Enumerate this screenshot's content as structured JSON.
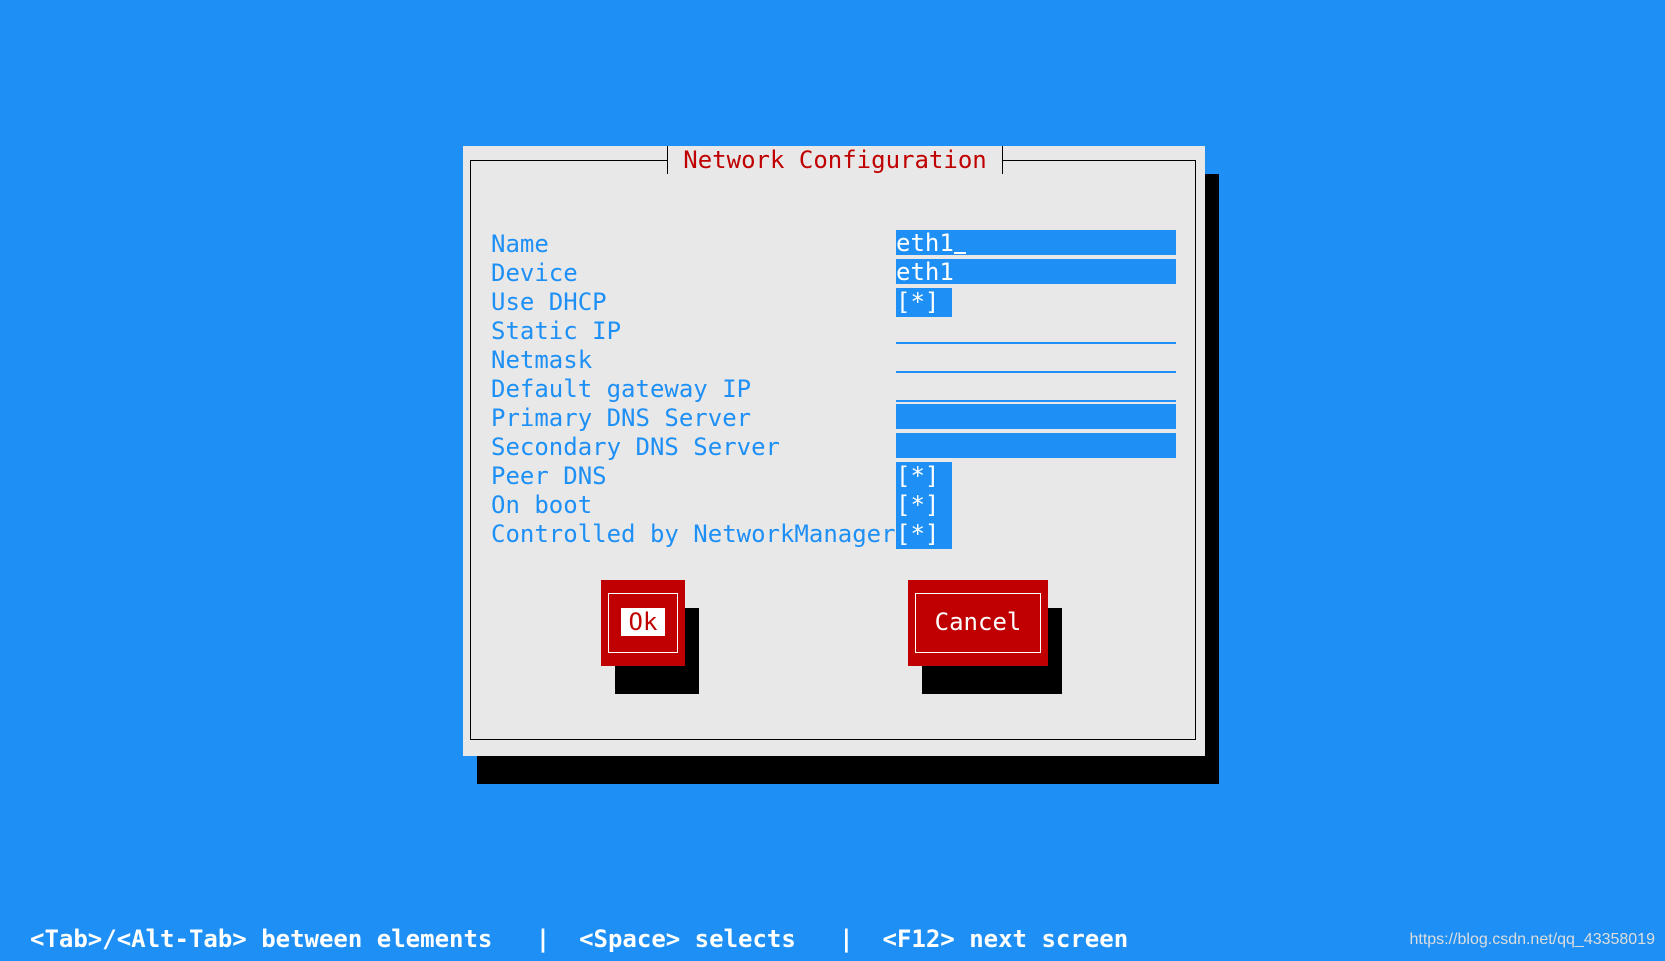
{
  "dialog": {
    "title": "Network Configuration",
    "fields": [
      {
        "label": "Name",
        "kind": "text",
        "value": "eth1",
        "filled": true
      },
      {
        "label": "Device",
        "kind": "text",
        "value": "eth1",
        "filled": true
      },
      {
        "label": "Use DHCP",
        "kind": "checkbox",
        "value": "[*]"
      },
      {
        "label": "Static IP",
        "kind": "text",
        "value": "",
        "filled": false
      },
      {
        "label": "Netmask",
        "kind": "text",
        "value": "",
        "filled": false
      },
      {
        "label": "Default gateway IP",
        "kind": "text",
        "value": "",
        "filled": false
      },
      {
        "label": "Primary DNS Server",
        "kind": "text",
        "value": "",
        "filled": true
      },
      {
        "label": "Secondary DNS Server",
        "kind": "text",
        "value": "",
        "filled": true
      },
      {
        "label": "Peer DNS",
        "kind": "checkbox",
        "value": "[*]"
      },
      {
        "label": "On boot",
        "kind": "checkbox",
        "value": "[*]"
      },
      {
        "label": "Controlled by NetworkManager",
        "kind": "checkbox",
        "value": "[*]"
      }
    ],
    "buttons": {
      "ok": "Ok",
      "cancel": "Cancel"
    }
  },
  "statusbar": {
    "text": "<Tab>/<Alt-Tab> between elements   |  <Space> selects   |  <F12> next screen"
  },
  "watermark": "https://blog.csdn.net/qq_43358019",
  "colors": {
    "background": "#1e90f5",
    "dialog": "#e8e8e8",
    "accent_red": "#c00000",
    "label_blue": "#1e90f5"
  }
}
